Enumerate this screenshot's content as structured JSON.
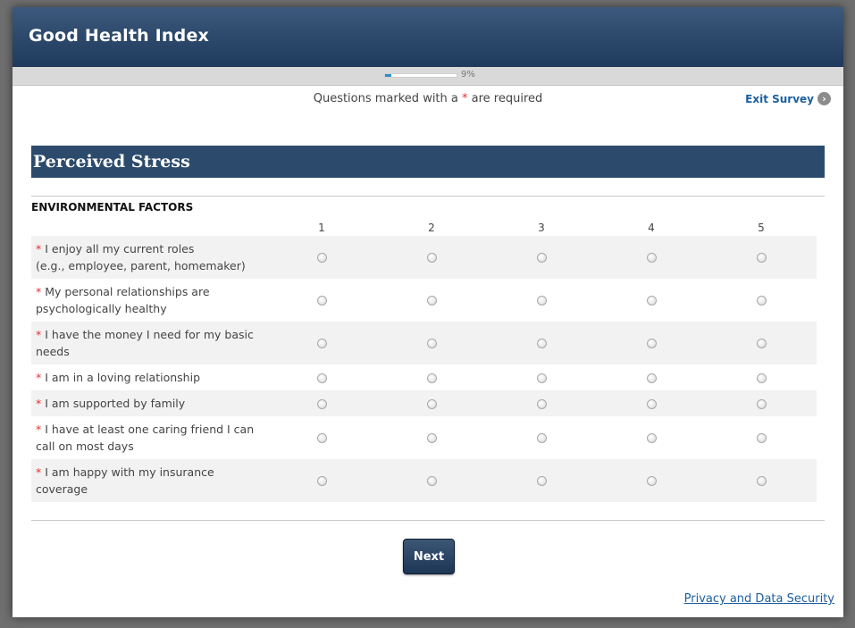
{
  "header": {
    "title": "Good Health Index"
  },
  "progress": {
    "percent": 9,
    "label": "9%"
  },
  "notice": {
    "before": "Questions marked with a ",
    "star": "*",
    "after": " are required"
  },
  "exit": {
    "label": "Exit Survey",
    "icon": "chevron-right-icon"
  },
  "section": {
    "title": "Perceived Stress"
  },
  "group": {
    "label": "ENVIRONMENTAL FACTORS"
  },
  "scale": [
    "1",
    "2",
    "3",
    "4",
    "5"
  ],
  "questions": [
    {
      "required_mark": "*",
      "line1": "I enjoy all my current roles",
      "line2": "(e.g., employee, parent, homemaker)"
    },
    {
      "required_mark": "*",
      "line1": "My personal relationships are",
      "line2": "psychologically healthy"
    },
    {
      "required_mark": "*",
      "line1": "I have the money I need for my basic",
      "line2": "needs"
    },
    {
      "required_mark": "*",
      "line1": "I am in a loving relationship",
      "line2": ""
    },
    {
      "required_mark": "*",
      "line1": "I am supported by family",
      "line2": ""
    },
    {
      "required_mark": "*",
      "line1": "I have at least one caring friend I can",
      "line2": "call on most days"
    },
    {
      "required_mark": "*",
      "line1": "I am happy with my insurance",
      "line2": "coverage"
    }
  ],
  "buttons": {
    "next": "Next"
  },
  "footer": {
    "privacy": "Privacy and Data Security"
  },
  "colors": {
    "header": "#2e4a6c",
    "section": "#2c4b6c",
    "link": "#1d5fa0",
    "required": "#dd3333",
    "progress": "#2a8fd0"
  }
}
